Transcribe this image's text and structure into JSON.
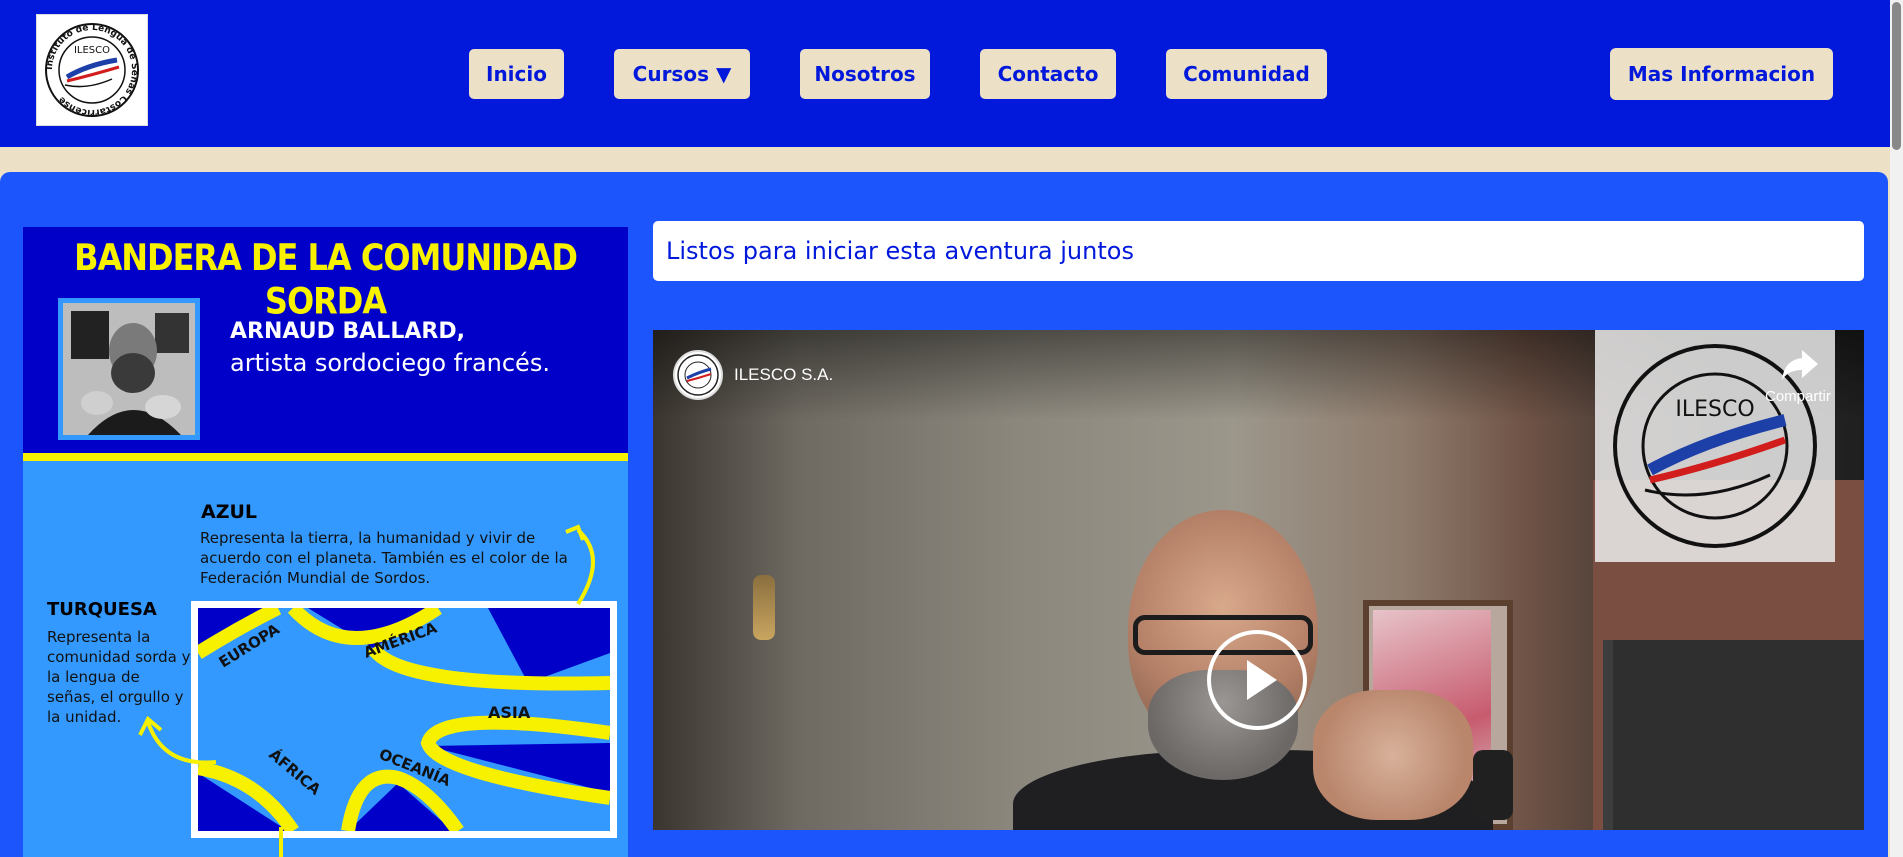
{
  "site": {
    "logo_text": "ILESCO",
    "logo_ring_text": "Instituto de Lengua de Señas Costarricense"
  },
  "nav": {
    "items": [
      {
        "label": "Inicio"
      },
      {
        "label": "Cursos ▼"
      },
      {
        "label": "Nosotros"
      },
      {
        "label": "Contacto"
      },
      {
        "label": "Comunidad"
      }
    ],
    "more_info": "Mas Informacion"
  },
  "poster": {
    "title": "BANDERA DE LA COMUNIDAD SORDA",
    "artist_name": "ARNAUD BALLARD,",
    "artist_desc": "artista sordociego francés.",
    "azul_title": "AZUL",
    "azul_text": "Representa la tierra, la humanidad y vivir de acuerdo con el planeta. También es el color de la Federación Mundial de Sordos.",
    "turquesa_title": "TURQUESA",
    "turquesa_text": "Representa la comunidad sorda y la lengua de señas, el orgullo y la unidad.",
    "flag_labels": {
      "europa": "EUROPA",
      "america": "AMÉRICA",
      "asia": "ASIA",
      "africa": "ÁFRICA",
      "oceania": "OCEANÍA"
    }
  },
  "banner": {
    "text": "Listos para iniciar esta aventura juntos"
  },
  "video": {
    "channel_name": "ILESCO S.A.",
    "share_label": "Compartir",
    "watermark_text": "ILESCO"
  },
  "colors": {
    "header_blue": "#0219dc",
    "main_blue": "#1c55fc",
    "cream": "#ece1c6",
    "poster_yellow": "#f7f100",
    "poster_light_blue": "#3399ff",
    "poster_dark_blue": "#0000c8"
  }
}
